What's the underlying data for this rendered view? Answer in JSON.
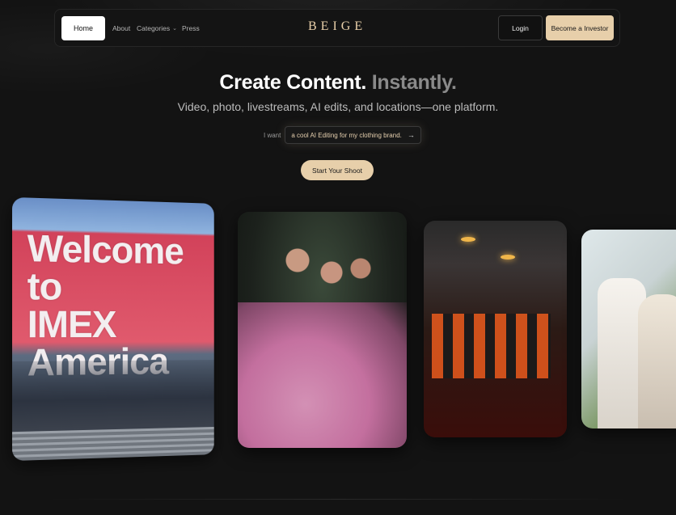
{
  "nav": {
    "home_label": "Home",
    "about_label": "About",
    "categories_label": "Categories",
    "press_label": "Press",
    "logo_text": "BEIGE",
    "login_label": "Login",
    "investor_label": "Become a Investor",
    "chevron_icon": "chevron-down-icon"
  },
  "hero": {
    "title_main": "Create Content.",
    "title_dim": "Instantly.",
    "subtitle": "Video, photo, livestreams, AI edits, and locations—one platform.",
    "prompt_prefix": "I want",
    "prompt_value": "a cool AI Editing for my clothing brand.",
    "prompt_arrow": "→",
    "cta_label": "Start Your Shoot"
  },
  "gallery": {
    "card1_sign_text": "Welcome to IMEX America",
    "card1_sign_line1": "Welcome to",
    "card1_sign_line2": "IMEX America"
  },
  "colors": {
    "accent": "#e7cfaa",
    "background": "#131313",
    "logo": "#e8cfa9"
  }
}
